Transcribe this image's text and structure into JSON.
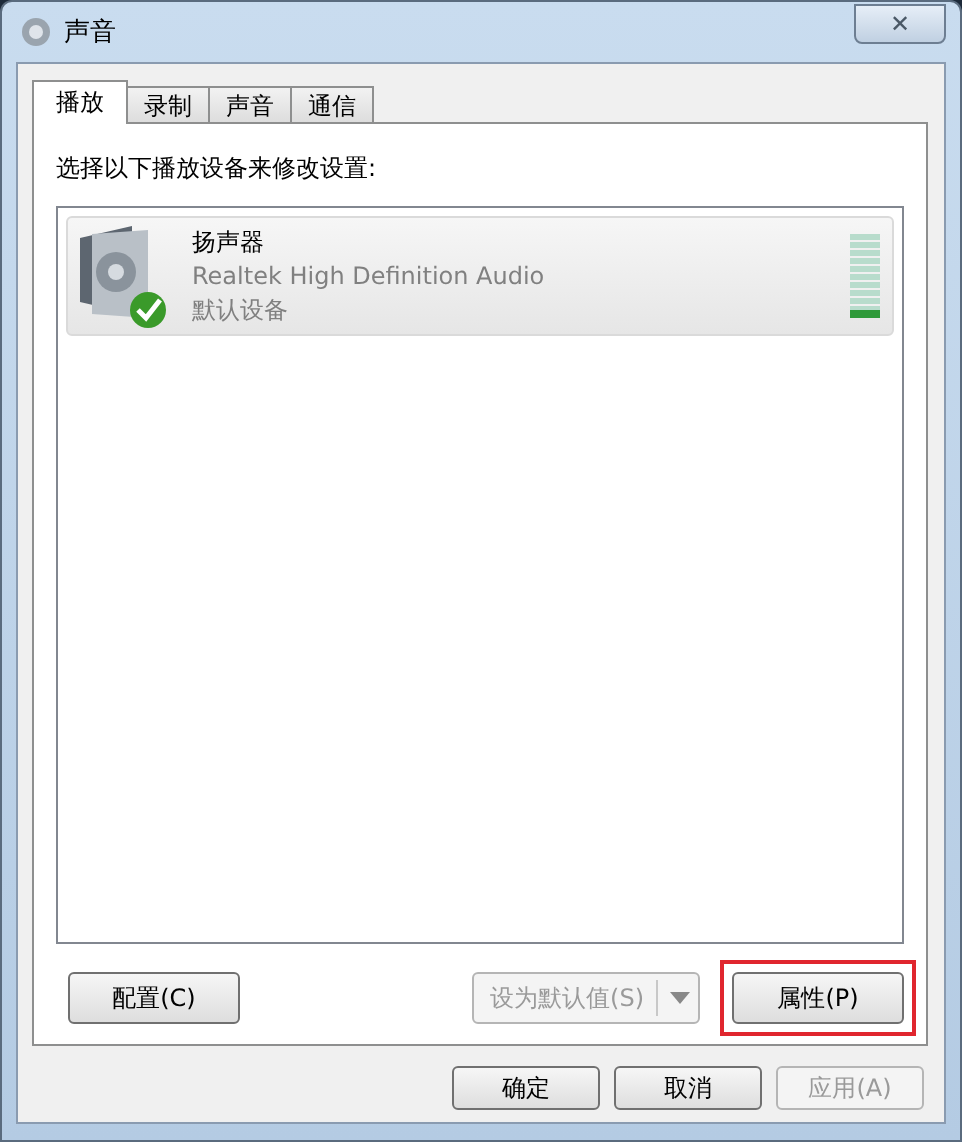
{
  "window": {
    "title": "声音",
    "close": "✕"
  },
  "tabs": [
    {
      "label": "播放",
      "selected": true
    },
    {
      "label": "录制",
      "selected": false
    },
    {
      "label": "声音",
      "selected": false
    },
    {
      "label": "通信",
      "selected": false
    }
  ],
  "instruction": "选择以下播放设备来修改设置:",
  "devices": [
    {
      "name": "扬声器",
      "driver": "Realtek High Definition Audio",
      "status": "默认设备",
      "default": true,
      "selected": true,
      "level": 0.1
    }
  ],
  "panel_buttons": [
    {
      "kind": "button",
      "label": "配置(C)",
      "disabled": false,
      "highlighted": false
    },
    {
      "kind": "split",
      "label": "设为默认值(S)",
      "disabled": true,
      "highlighted": false
    },
    {
      "kind": "button",
      "label": "属性(P)",
      "disabled": false,
      "highlighted": true
    }
  ],
  "dialog_buttons": [
    {
      "label": "确定",
      "disabled": false
    },
    {
      "label": "取消",
      "disabled": false
    },
    {
      "label": "应用(A)",
      "disabled": true
    }
  ]
}
